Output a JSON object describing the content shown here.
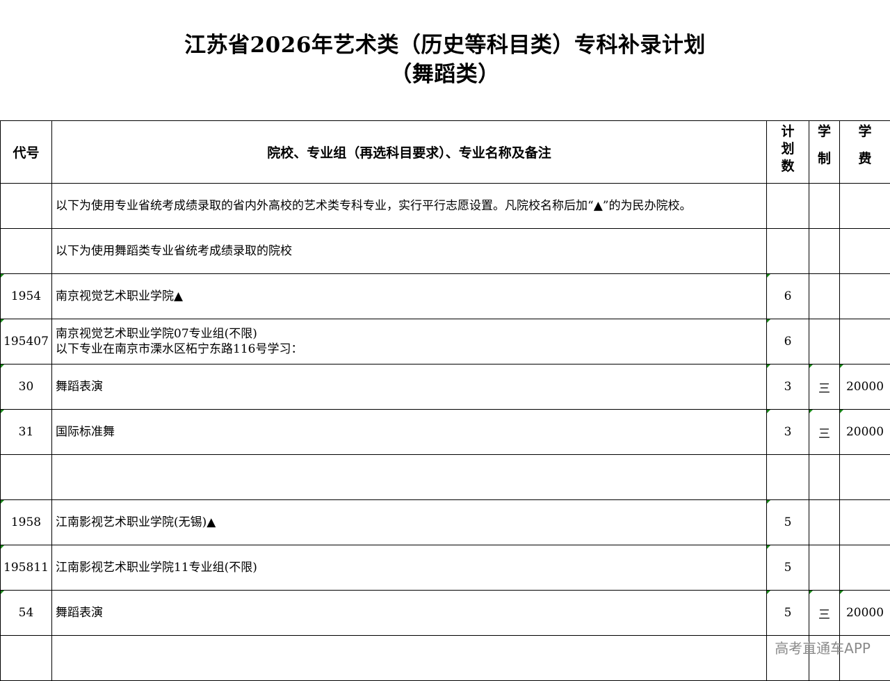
{
  "title": {
    "line1": "江苏省2026年艺术类（历史等科目类）专科补录计划",
    "line2": "（舞蹈类）"
  },
  "table": {
    "headers": {
      "code": "代号",
      "name": "院校、专业组（再选科目要求）、专业名称及备注",
      "plan": [
        "计",
        "划",
        "数"
      ],
      "duration": [
        "学",
        "制"
      ],
      "fee": [
        "学",
        "费"
      ]
    },
    "rows": [
      {
        "code": "",
        "line1": "以下为使用专业省统考成绩录取的省内外高校的艺术类专科专业，实行平行志愿设置。凡院校名称后加“▲”的为民办院校。",
        "line2": "",
        "plan": "",
        "duration": "",
        "fee": ""
      },
      {
        "code": "",
        "line1": "以下为使用舞蹈类专业省统考成绩录取的院校",
        "line2": "",
        "plan": "",
        "duration": "",
        "fee": ""
      },
      {
        "code": "1954",
        "line1": "南京视觉艺术职业学院▲",
        "line2": "",
        "plan": "6",
        "duration": "",
        "fee": ""
      },
      {
        "code": "195407",
        "line1": "南京视觉艺术职业学院07专业组(不限)",
        "line2": "以下专业在南京市溧水区柘宁东路116号学习：",
        "plan": "6",
        "duration": "",
        "fee": ""
      },
      {
        "code": "30",
        "line1": "舞蹈表演",
        "line2": "",
        "plan": "3",
        "duration": "三",
        "fee": "20000"
      },
      {
        "code": "31",
        "line1": "国际标准舞",
        "line2": "",
        "plan": "3",
        "duration": "三",
        "fee": "20000"
      },
      {
        "code": "",
        "line1": "",
        "line2": "",
        "plan": "",
        "duration": "",
        "fee": ""
      },
      {
        "code": "1958",
        "line1": "江南影视艺术职业学院(无锡)▲",
        "line2": "",
        "plan": "5",
        "duration": "",
        "fee": ""
      },
      {
        "code": "195811",
        "line1": "江南影视艺术职业学院11专业组(不限)",
        "line2": "",
        "plan": "5",
        "duration": "",
        "fee": ""
      },
      {
        "code": "54",
        "line1": "舞蹈表演",
        "line2": "",
        "plan": "5",
        "duration": "三",
        "fee": "20000"
      },
      {
        "code": "",
        "line1": "",
        "line2": "",
        "plan": "",
        "duration": "",
        "fee": ""
      }
    ]
  },
  "watermark": "高考直通车APP",
  "colors": {
    "border": "#000000",
    "cell_marker": "#1a8a1a",
    "watermark": "#8a8a8a"
  }
}
